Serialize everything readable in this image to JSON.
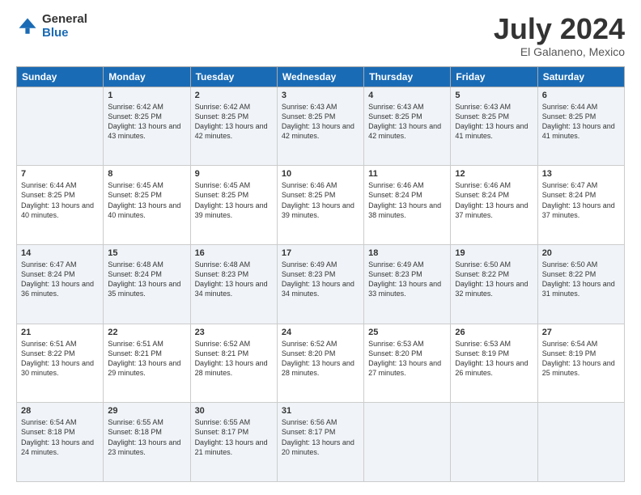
{
  "logo": {
    "general": "General",
    "blue": "Blue"
  },
  "title": "July 2024",
  "location": "El Galaneno, Mexico",
  "days_of_week": [
    "Sunday",
    "Monday",
    "Tuesday",
    "Wednesday",
    "Thursday",
    "Friday",
    "Saturday"
  ],
  "weeks": [
    [
      {
        "day": "",
        "sunrise": "",
        "sunset": "",
        "daylight": ""
      },
      {
        "day": "1",
        "sunrise": "Sunrise: 6:42 AM",
        "sunset": "Sunset: 8:25 PM",
        "daylight": "Daylight: 13 hours and 43 minutes."
      },
      {
        "day": "2",
        "sunrise": "Sunrise: 6:42 AM",
        "sunset": "Sunset: 8:25 PM",
        "daylight": "Daylight: 13 hours and 42 minutes."
      },
      {
        "day": "3",
        "sunrise": "Sunrise: 6:43 AM",
        "sunset": "Sunset: 8:25 PM",
        "daylight": "Daylight: 13 hours and 42 minutes."
      },
      {
        "day": "4",
        "sunrise": "Sunrise: 6:43 AM",
        "sunset": "Sunset: 8:25 PM",
        "daylight": "Daylight: 13 hours and 42 minutes."
      },
      {
        "day": "5",
        "sunrise": "Sunrise: 6:43 AM",
        "sunset": "Sunset: 8:25 PM",
        "daylight": "Daylight: 13 hours and 41 minutes."
      },
      {
        "day": "6",
        "sunrise": "Sunrise: 6:44 AM",
        "sunset": "Sunset: 8:25 PM",
        "daylight": "Daylight: 13 hours and 41 minutes."
      }
    ],
    [
      {
        "day": "7",
        "sunrise": "Sunrise: 6:44 AM",
        "sunset": "Sunset: 8:25 PM",
        "daylight": "Daylight: 13 hours and 40 minutes."
      },
      {
        "day": "8",
        "sunrise": "Sunrise: 6:45 AM",
        "sunset": "Sunset: 8:25 PM",
        "daylight": "Daylight: 13 hours and 40 minutes."
      },
      {
        "day": "9",
        "sunrise": "Sunrise: 6:45 AM",
        "sunset": "Sunset: 8:25 PM",
        "daylight": "Daylight: 13 hours and 39 minutes."
      },
      {
        "day": "10",
        "sunrise": "Sunrise: 6:46 AM",
        "sunset": "Sunset: 8:25 PM",
        "daylight": "Daylight: 13 hours and 39 minutes."
      },
      {
        "day": "11",
        "sunrise": "Sunrise: 6:46 AM",
        "sunset": "Sunset: 8:24 PM",
        "daylight": "Daylight: 13 hours and 38 minutes."
      },
      {
        "day": "12",
        "sunrise": "Sunrise: 6:46 AM",
        "sunset": "Sunset: 8:24 PM",
        "daylight": "Daylight: 13 hours and 37 minutes."
      },
      {
        "day": "13",
        "sunrise": "Sunrise: 6:47 AM",
        "sunset": "Sunset: 8:24 PM",
        "daylight": "Daylight: 13 hours and 37 minutes."
      }
    ],
    [
      {
        "day": "14",
        "sunrise": "Sunrise: 6:47 AM",
        "sunset": "Sunset: 8:24 PM",
        "daylight": "Daylight: 13 hours and 36 minutes."
      },
      {
        "day": "15",
        "sunrise": "Sunrise: 6:48 AM",
        "sunset": "Sunset: 8:24 PM",
        "daylight": "Daylight: 13 hours and 35 minutes."
      },
      {
        "day": "16",
        "sunrise": "Sunrise: 6:48 AM",
        "sunset": "Sunset: 8:23 PM",
        "daylight": "Daylight: 13 hours and 34 minutes."
      },
      {
        "day": "17",
        "sunrise": "Sunrise: 6:49 AM",
        "sunset": "Sunset: 8:23 PM",
        "daylight": "Daylight: 13 hours and 34 minutes."
      },
      {
        "day": "18",
        "sunrise": "Sunrise: 6:49 AM",
        "sunset": "Sunset: 8:23 PM",
        "daylight": "Daylight: 13 hours and 33 minutes."
      },
      {
        "day": "19",
        "sunrise": "Sunrise: 6:50 AM",
        "sunset": "Sunset: 8:22 PM",
        "daylight": "Daylight: 13 hours and 32 minutes."
      },
      {
        "day": "20",
        "sunrise": "Sunrise: 6:50 AM",
        "sunset": "Sunset: 8:22 PM",
        "daylight": "Daylight: 13 hours and 31 minutes."
      }
    ],
    [
      {
        "day": "21",
        "sunrise": "Sunrise: 6:51 AM",
        "sunset": "Sunset: 8:22 PM",
        "daylight": "Daylight: 13 hours and 30 minutes."
      },
      {
        "day": "22",
        "sunrise": "Sunrise: 6:51 AM",
        "sunset": "Sunset: 8:21 PM",
        "daylight": "Daylight: 13 hours and 29 minutes."
      },
      {
        "day": "23",
        "sunrise": "Sunrise: 6:52 AM",
        "sunset": "Sunset: 8:21 PM",
        "daylight": "Daylight: 13 hours and 28 minutes."
      },
      {
        "day": "24",
        "sunrise": "Sunrise: 6:52 AM",
        "sunset": "Sunset: 8:20 PM",
        "daylight": "Daylight: 13 hours and 28 minutes."
      },
      {
        "day": "25",
        "sunrise": "Sunrise: 6:53 AM",
        "sunset": "Sunset: 8:20 PM",
        "daylight": "Daylight: 13 hours and 27 minutes."
      },
      {
        "day": "26",
        "sunrise": "Sunrise: 6:53 AM",
        "sunset": "Sunset: 8:19 PM",
        "daylight": "Daylight: 13 hours and 26 minutes."
      },
      {
        "day": "27",
        "sunrise": "Sunrise: 6:54 AM",
        "sunset": "Sunset: 8:19 PM",
        "daylight": "Daylight: 13 hours and 25 minutes."
      }
    ],
    [
      {
        "day": "28",
        "sunrise": "Sunrise: 6:54 AM",
        "sunset": "Sunset: 8:18 PM",
        "daylight": "Daylight: 13 hours and 24 minutes."
      },
      {
        "day": "29",
        "sunrise": "Sunrise: 6:55 AM",
        "sunset": "Sunset: 8:18 PM",
        "daylight": "Daylight: 13 hours and 23 minutes."
      },
      {
        "day": "30",
        "sunrise": "Sunrise: 6:55 AM",
        "sunset": "Sunset: 8:17 PM",
        "daylight": "Daylight: 13 hours and 21 minutes."
      },
      {
        "day": "31",
        "sunrise": "Sunrise: 6:56 AM",
        "sunset": "Sunset: 8:17 PM",
        "daylight": "Daylight: 13 hours and 20 minutes."
      },
      {
        "day": "",
        "sunrise": "",
        "sunset": "",
        "daylight": ""
      },
      {
        "day": "",
        "sunrise": "",
        "sunset": "",
        "daylight": ""
      },
      {
        "day": "",
        "sunrise": "",
        "sunset": "",
        "daylight": ""
      }
    ]
  ]
}
